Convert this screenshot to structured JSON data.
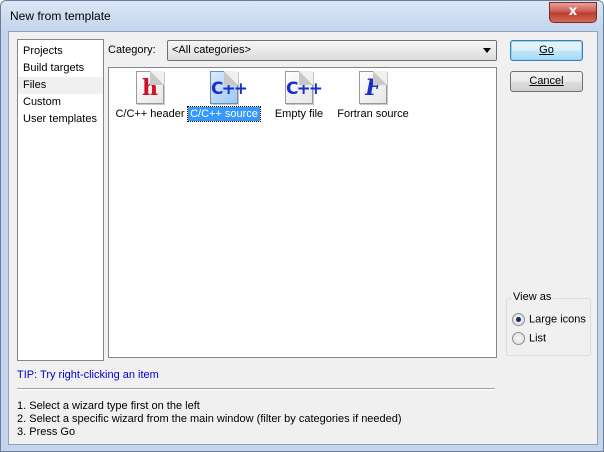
{
  "window": {
    "title": "New from template",
    "close_glyph": "x"
  },
  "sidebar": {
    "items": [
      {
        "label": "Projects"
      },
      {
        "label": "Build targets"
      },
      {
        "label": "Files",
        "selected": true
      },
      {
        "label": "Custom"
      },
      {
        "label": "User templates"
      }
    ]
  },
  "category": {
    "label": "Category:",
    "value": "<All categories>"
  },
  "templates": [
    {
      "label": "C/C++ header",
      "icon": "cpp-header-file-icon",
      "glyph": "h",
      "selected": false
    },
    {
      "label": "C/C++ source",
      "icon": "cpp-source-file-icon",
      "glyph": "C++",
      "selected": true
    },
    {
      "label": "Empty file",
      "icon": "empty-file-icon",
      "glyph": "C++",
      "selected": false
    },
    {
      "label": "Fortran source",
      "icon": "fortran-source-file-icon",
      "glyph": "F",
      "selected": false
    }
  ],
  "buttons": {
    "go": "Go",
    "cancel": "Cancel"
  },
  "view_as": {
    "legend": "View as",
    "options": [
      {
        "label": "Large icons",
        "checked": true
      },
      {
        "label": "List",
        "checked": false
      }
    ]
  },
  "tip": "TIP: Try right-clicking an item",
  "instructions": [
    "1. Select a wizard type first on the left",
    "2. Select a specific wizard from the main window (filter by categories if needed)",
    "3. Press Go"
  ],
  "colors": {
    "selection": "#3399ff",
    "tip_text": "#0000cc",
    "header_icon_glyph": "#d0102a",
    "cpp_icon_glyph": "#1a2fc9"
  }
}
